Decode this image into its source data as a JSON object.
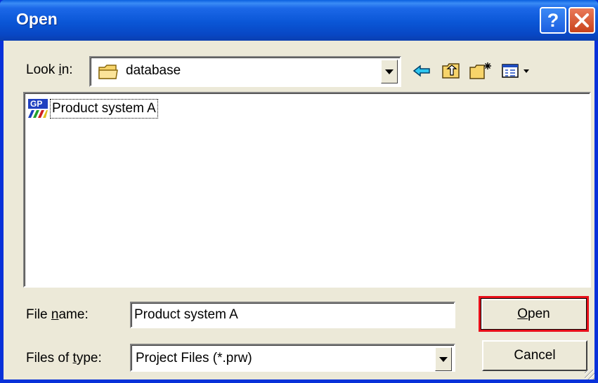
{
  "window": {
    "title": "Open",
    "help_label": "?",
    "close_icon": "close-icon",
    "help_icon": "help-icon"
  },
  "look_in": {
    "label_pre": "Look ",
    "label_accel": "i",
    "label_post": "n:",
    "folder_icon": "folder-icon",
    "value": "database"
  },
  "toolbar": {
    "back_icon": "back-arrow-icon",
    "up_icon": "up-one-level-icon",
    "new_folder_icon": "new-folder-icon",
    "view_menu_icon": "view-menu-icon"
  },
  "file_list": {
    "items": [
      {
        "name": "Product system A",
        "icon": "gp-project-icon",
        "icon_text": "GP"
      }
    ]
  },
  "file_name": {
    "label_pre": "File ",
    "label_accel": "n",
    "label_post": "ame:",
    "value": "Product system A"
  },
  "file_type": {
    "label_pre": "Files of ",
    "label_accel": "t",
    "label_post": "ype:",
    "value": "Project Files (*.prw)"
  },
  "buttons": {
    "open_accel": "O",
    "open_rest": "pen",
    "cancel": "Cancel"
  },
  "colors": {
    "titlebar": "#0a56d6",
    "dialog_bg": "#ece9d8",
    "highlight_border": "#e8101a",
    "close_button": "#c9431c"
  }
}
